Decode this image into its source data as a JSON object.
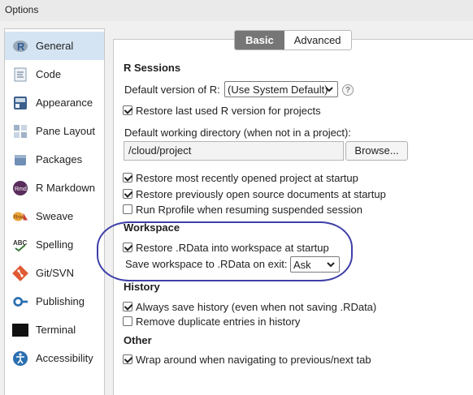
{
  "window": {
    "title": "Options"
  },
  "sidebar": {
    "items": [
      {
        "label": "General",
        "icon": "r-logo-icon",
        "selected": true
      },
      {
        "label": "Code",
        "icon": "code-icon",
        "selected": false
      },
      {
        "label": "Appearance",
        "icon": "appearance-icon",
        "selected": false
      },
      {
        "label": "Pane Layout",
        "icon": "pane-layout-icon",
        "selected": false
      },
      {
        "label": "Packages",
        "icon": "packages-icon",
        "selected": false
      },
      {
        "label": "R Markdown",
        "icon": "rmarkdown-icon",
        "selected": false
      },
      {
        "label": "Sweave",
        "icon": "sweave-icon",
        "selected": false
      },
      {
        "label": "Spelling",
        "icon": "spelling-icon",
        "selected": false
      },
      {
        "label": "Git/SVN",
        "icon": "git-icon",
        "selected": false
      },
      {
        "label": "Publishing",
        "icon": "publishing-icon",
        "selected": false
      },
      {
        "label": "Terminal",
        "icon": "terminal-icon",
        "selected": false
      },
      {
        "label": "Accessibility",
        "icon": "accessibility-icon",
        "selected": false
      }
    ]
  },
  "tabs": {
    "basic": "Basic",
    "advanced": "Advanced"
  },
  "r_sessions": {
    "title": "R Sessions",
    "default_version_label": "Default version of R:",
    "default_version_value": "(Use System Default)",
    "help": "?",
    "restore_version": {
      "label": "Restore last used R version for projects",
      "checked": true
    },
    "working_dir_label": "Default working directory (when not in a project):",
    "working_dir_value": "/cloud/project",
    "browse_label": "Browse...",
    "restore_project": {
      "label": "Restore most recently opened project at startup",
      "checked": true
    },
    "restore_docs": {
      "label": "Restore previously open source documents at startup",
      "checked": true
    },
    "run_rprofile": {
      "label": "Run Rprofile when resuming suspended session",
      "checked": false
    }
  },
  "workspace": {
    "title": "Workspace",
    "restore_rdata": {
      "label": "Restore .RData into workspace at startup",
      "checked": true
    },
    "save_label": "Save workspace to .RData on exit:",
    "save_value": "Ask"
  },
  "history": {
    "title": "History",
    "always_save": {
      "label": "Always save history (even when not saving .RData)",
      "checked": true
    },
    "remove_dupes": {
      "label": "Remove duplicate entries in history",
      "checked": false
    }
  },
  "other": {
    "title": "Other",
    "wrap_around": {
      "label": "Wrap around when navigating to previous/next tab",
      "checked": true
    }
  },
  "colors": {
    "selected_bg": "#d5e4f2",
    "annotation": "#3e3fa8",
    "active_tab": "#767676"
  }
}
